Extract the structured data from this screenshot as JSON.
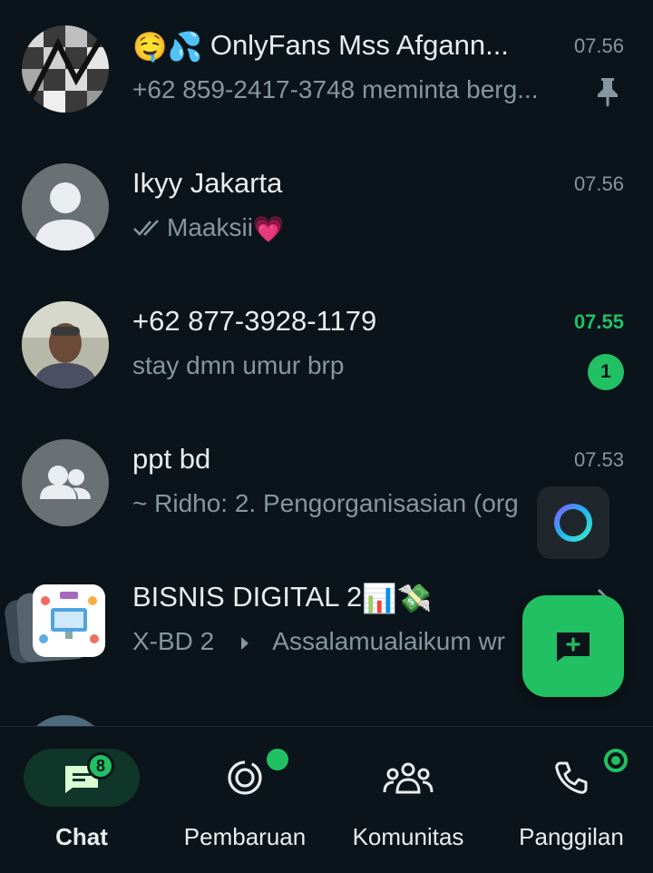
{
  "colors": {
    "background": "#0b141a",
    "accent": "#21c063",
    "text_primary": "#e9edef",
    "text_secondary": "#8696a0"
  },
  "chats": [
    {
      "name_emoji": "🤤💦",
      "name": "OnlyFans Mss Afgann...",
      "preview": "+62 859-2417-3748 meminta berg...",
      "time": "07.56",
      "pinned": true,
      "avatar_icon": "photo-avatar"
    },
    {
      "name": "Ikyy Jakarta",
      "preview": "Maaksii",
      "preview_emoji": "💗",
      "time": "07.56",
      "read_receipt": "double-check-icon",
      "avatar_icon": "person-icon"
    },
    {
      "name": "+62 877-3928-1179",
      "preview": "stay dmn umur brp",
      "time": "07.55",
      "unread_count": "1",
      "avatar_icon": "photo-avatar"
    },
    {
      "name": "ppt bd",
      "preview": "~ Ridho: 2. Pengorganisasian (org",
      "time": "07.53",
      "avatar_icon": "group-icon"
    },
    {
      "name": "BISNIS DIGITAL 2",
      "name_emoji": "📊💸",
      "sub_group": "X-BD 2",
      "preview": "Assalamualaikum wr",
      "avatar_icon": "community-avatar"
    }
  ],
  "bottom_nav": [
    {
      "label": "Chat",
      "icon": "chat-icon",
      "badge": "8",
      "active": true
    },
    {
      "label": "Pembaruan",
      "icon": "status-icon",
      "dot": true
    },
    {
      "label": "Komunitas",
      "icon": "community-icon"
    },
    {
      "label": "Panggilan",
      "icon": "phone-icon",
      "dot": true
    }
  ],
  "fab_icon": "new-chat-icon",
  "floating_widget_icon": "assistant-ring-icon"
}
